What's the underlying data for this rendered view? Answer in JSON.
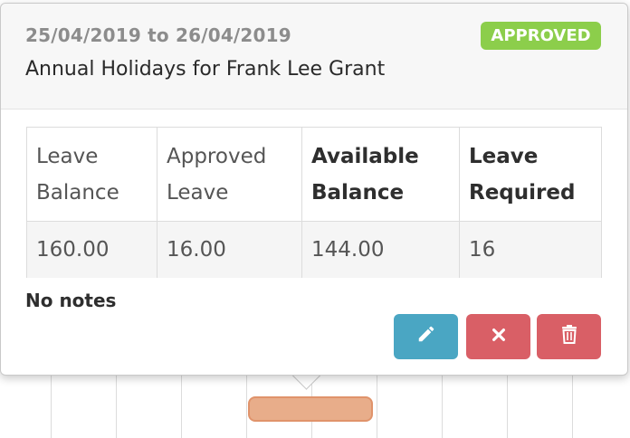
{
  "popover": {
    "date_range": "25/04/2019 to 26/04/2019",
    "status_badge": "APPROVED",
    "title": "Annual Holidays for Frank Lee Grant",
    "notes": "No notes"
  },
  "table": {
    "headers": [
      {
        "line1": "Leave",
        "line2": "Balance"
      },
      {
        "line1": "Approved",
        "line2": "Leave"
      },
      {
        "line1": "Available",
        "line2": "Balance"
      },
      {
        "line1": "Leave",
        "line2": "Required"
      }
    ],
    "values": [
      "160.00",
      "16.00",
      "144.00",
      "16"
    ]
  },
  "actions": {
    "edit_icon": "pencil-icon",
    "cancel_icon": "close-icon",
    "delete_icon": "trash-icon"
  },
  "colors": {
    "approved": "#8cce4b",
    "edit": "#4aa6c3",
    "danger": "#d95f66",
    "event_bar": "#e8ad8a"
  }
}
